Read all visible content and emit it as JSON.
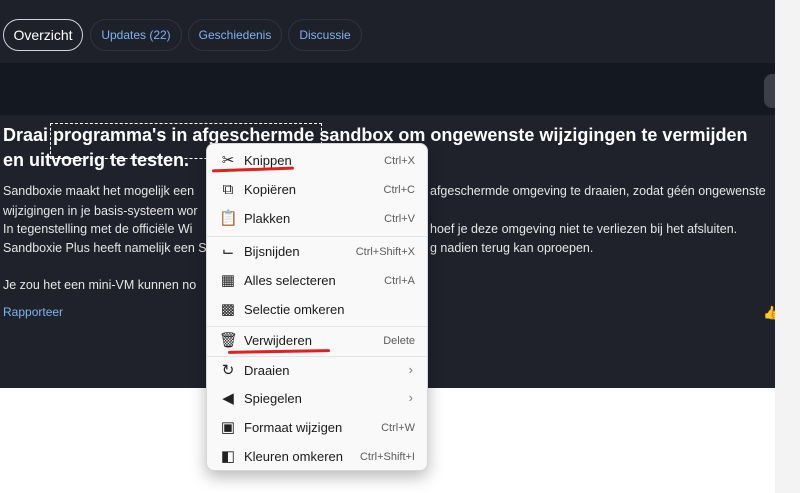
{
  "tabs": [
    {
      "label": "Overzicht"
    },
    {
      "label": "Updates (22)"
    },
    {
      "label": "Geschiedenis"
    },
    {
      "label": "Discussie"
    }
  ],
  "article": {
    "title": "Draai programma's in afgeschermde sandbox om ongewenste wijzigingen te vermijden en uitvoerig te testen.",
    "para_lines": [
      "Sandboxie maakt het mogelijk een",
      "wijzigingen in je basis-systeem wor",
      "In tegenstelling met de officiële Wi",
      "Sandboxie Plus heeft namelijk een S",
      "Je zou het een mini-VM kunnen no"
    ],
    "para_lines_right": [
      "afgeschermde omgeving te draaien, zodat géén ongewenste",
      "",
      "hoef je deze omgeving niet te verliezen bij het afsluiten.",
      "g nadien terug kan oproepen."
    ],
    "report_label": "Rapporteer"
  },
  "context_menu": {
    "items": [
      {
        "label": "Knippen",
        "shortcut": "Ctrl+X",
        "icon": "scissors-icon"
      },
      {
        "label": "Kopiëren",
        "shortcut": "Ctrl+C",
        "icon": "copy-icon"
      },
      {
        "label": "Plakken",
        "shortcut": "Ctrl+V",
        "icon": "paste-icon"
      },
      {
        "label": "Bijsnijden",
        "shortcut": "Ctrl+Shift+X",
        "icon": "crop-icon"
      },
      {
        "label": "Alles selecteren",
        "shortcut": "Ctrl+A",
        "icon": "select-all-icon"
      },
      {
        "label": "Selectie omkeren",
        "shortcut": "",
        "icon": "invert-selection-icon"
      },
      {
        "label": "Verwijderen",
        "shortcut": "Delete",
        "icon": "trash-icon"
      },
      {
        "label": "Draaien",
        "shortcut": "",
        "icon": "rotate-icon",
        "submenu": true
      },
      {
        "label": "Spiegelen",
        "shortcut": "",
        "icon": "mirror-icon",
        "submenu": true
      },
      {
        "label": "Formaat wijzigen",
        "shortcut": "Ctrl+W",
        "icon": "resize-icon"
      },
      {
        "label": "Kleuren omkeren",
        "shortcut": "Ctrl+Shift+I",
        "icon": "invert-colors-icon"
      }
    ]
  },
  "colors": {
    "accent": "#7fb2ef",
    "annotation": "#e02020",
    "panel": "#1f222b"
  }
}
